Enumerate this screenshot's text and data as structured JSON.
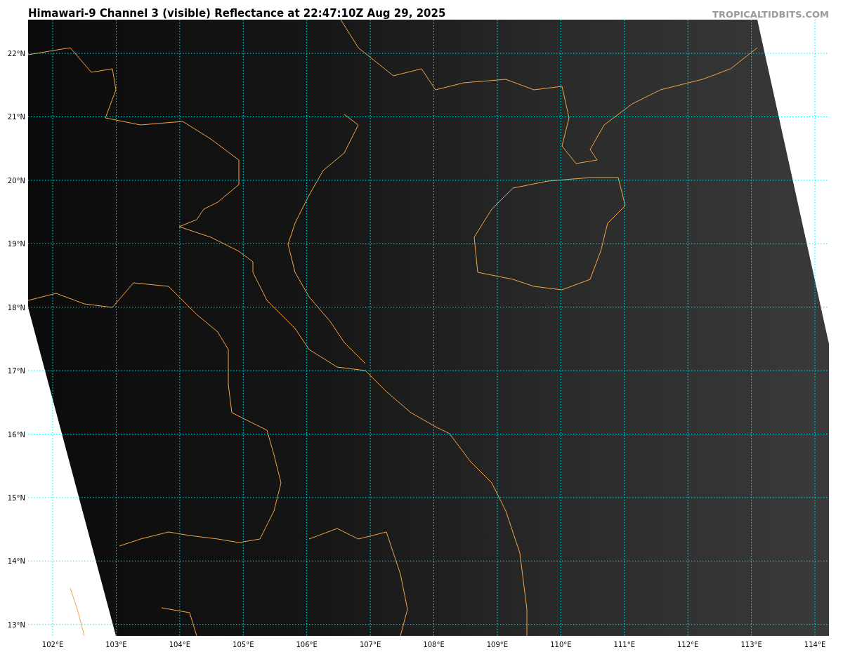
{
  "title": "Himawari-9 Channel 3 (visible) Reflectance at 22:47:10Z Aug 29, 2025",
  "credit": "TROPICALTIDBITS.COM",
  "lat_labels": [
    "22°N",
    "21°N",
    "20°N",
    "19°N",
    "18°N",
    "17°N",
    "16°N",
    "15°N",
    "14°N",
    "13°N"
  ],
  "lon_labels": [
    "102°E",
    "103°E",
    "104°E",
    "105°E",
    "106°E",
    "107°E",
    "108°E",
    "109°E",
    "110°E",
    "111°E",
    "112°E",
    "113°E",
    "114°E"
  ]
}
